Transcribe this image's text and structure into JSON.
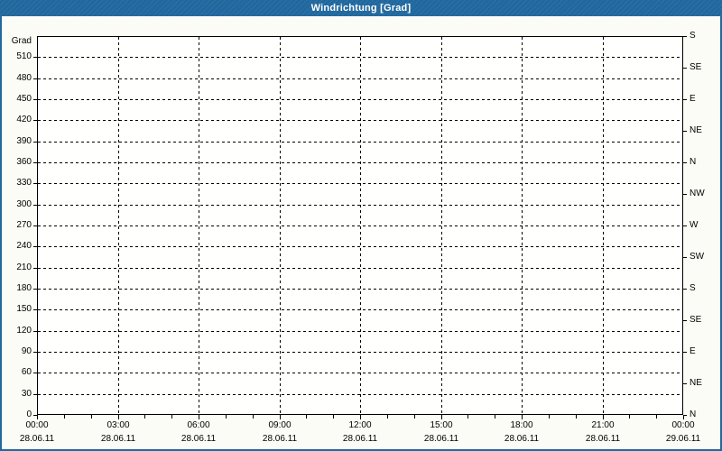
{
  "colors": {
    "titlebar_bg": "#21689e",
    "window_border": "#21689e",
    "content_bg": "#fcfcf6",
    "plot_bg": "#fffffd",
    "grid_color": "#000000",
    "title_text": "#ffffff",
    "axis_text": "#000000"
  },
  "chart_data": {
    "type": "line",
    "title": "Windrichtung [Grad]",
    "grid": "dashed",
    "legend": "none",
    "series": [],
    "y_axis_left": {
      "label": "Grad",
      "min": 0,
      "max": 540,
      "step": 30,
      "tick_values": [
        0,
        30,
        60,
        90,
        120,
        150,
        180,
        210,
        240,
        270,
        300,
        330,
        360,
        390,
        420,
        450,
        480,
        510
      ]
    },
    "y_axis_right": {
      "ticks": [
        {
          "value": 0,
          "label": "N"
        },
        {
          "value": 45,
          "label": "NE"
        },
        {
          "value": 90,
          "label": "E"
        },
        {
          "value": 135,
          "label": "SE"
        },
        {
          "value": 180,
          "label": "S"
        },
        {
          "value": 225,
          "label": "SW"
        },
        {
          "value": 270,
          "label": "W"
        },
        {
          "value": 315,
          "label": "NW"
        },
        {
          "value": 360,
          "label": "N"
        },
        {
          "value": 405,
          "label": "NE"
        },
        {
          "value": 450,
          "label": "E"
        },
        {
          "value": 495,
          "label": "SE"
        },
        {
          "value": 540,
          "label": "S"
        }
      ]
    },
    "x_axis": {
      "range_hours": [
        0,
        24
      ],
      "major_step_hours": 3,
      "minor_step_hours": 1,
      "ticks": [
        {
          "hour": 0,
          "time": "00:00",
          "date": "28.06.11"
        },
        {
          "hour": 3,
          "time": "03:00",
          "date": "28.06.11"
        },
        {
          "hour": 6,
          "time": "06:00",
          "date": "28.06.11"
        },
        {
          "hour": 9,
          "time": "09:00",
          "date": "28.06.11"
        },
        {
          "hour": 12,
          "time": "12:00",
          "date": "28.06.11"
        },
        {
          "hour": 15,
          "time": "15:00",
          "date": "28.06.11"
        },
        {
          "hour": 18,
          "time": "18:00",
          "date": "28.06.11"
        },
        {
          "hour": 21,
          "time": "21:00",
          "date": "28.06.11"
        },
        {
          "hour": 24,
          "time": "00:00",
          "date": "29.06.11"
        }
      ]
    }
  }
}
